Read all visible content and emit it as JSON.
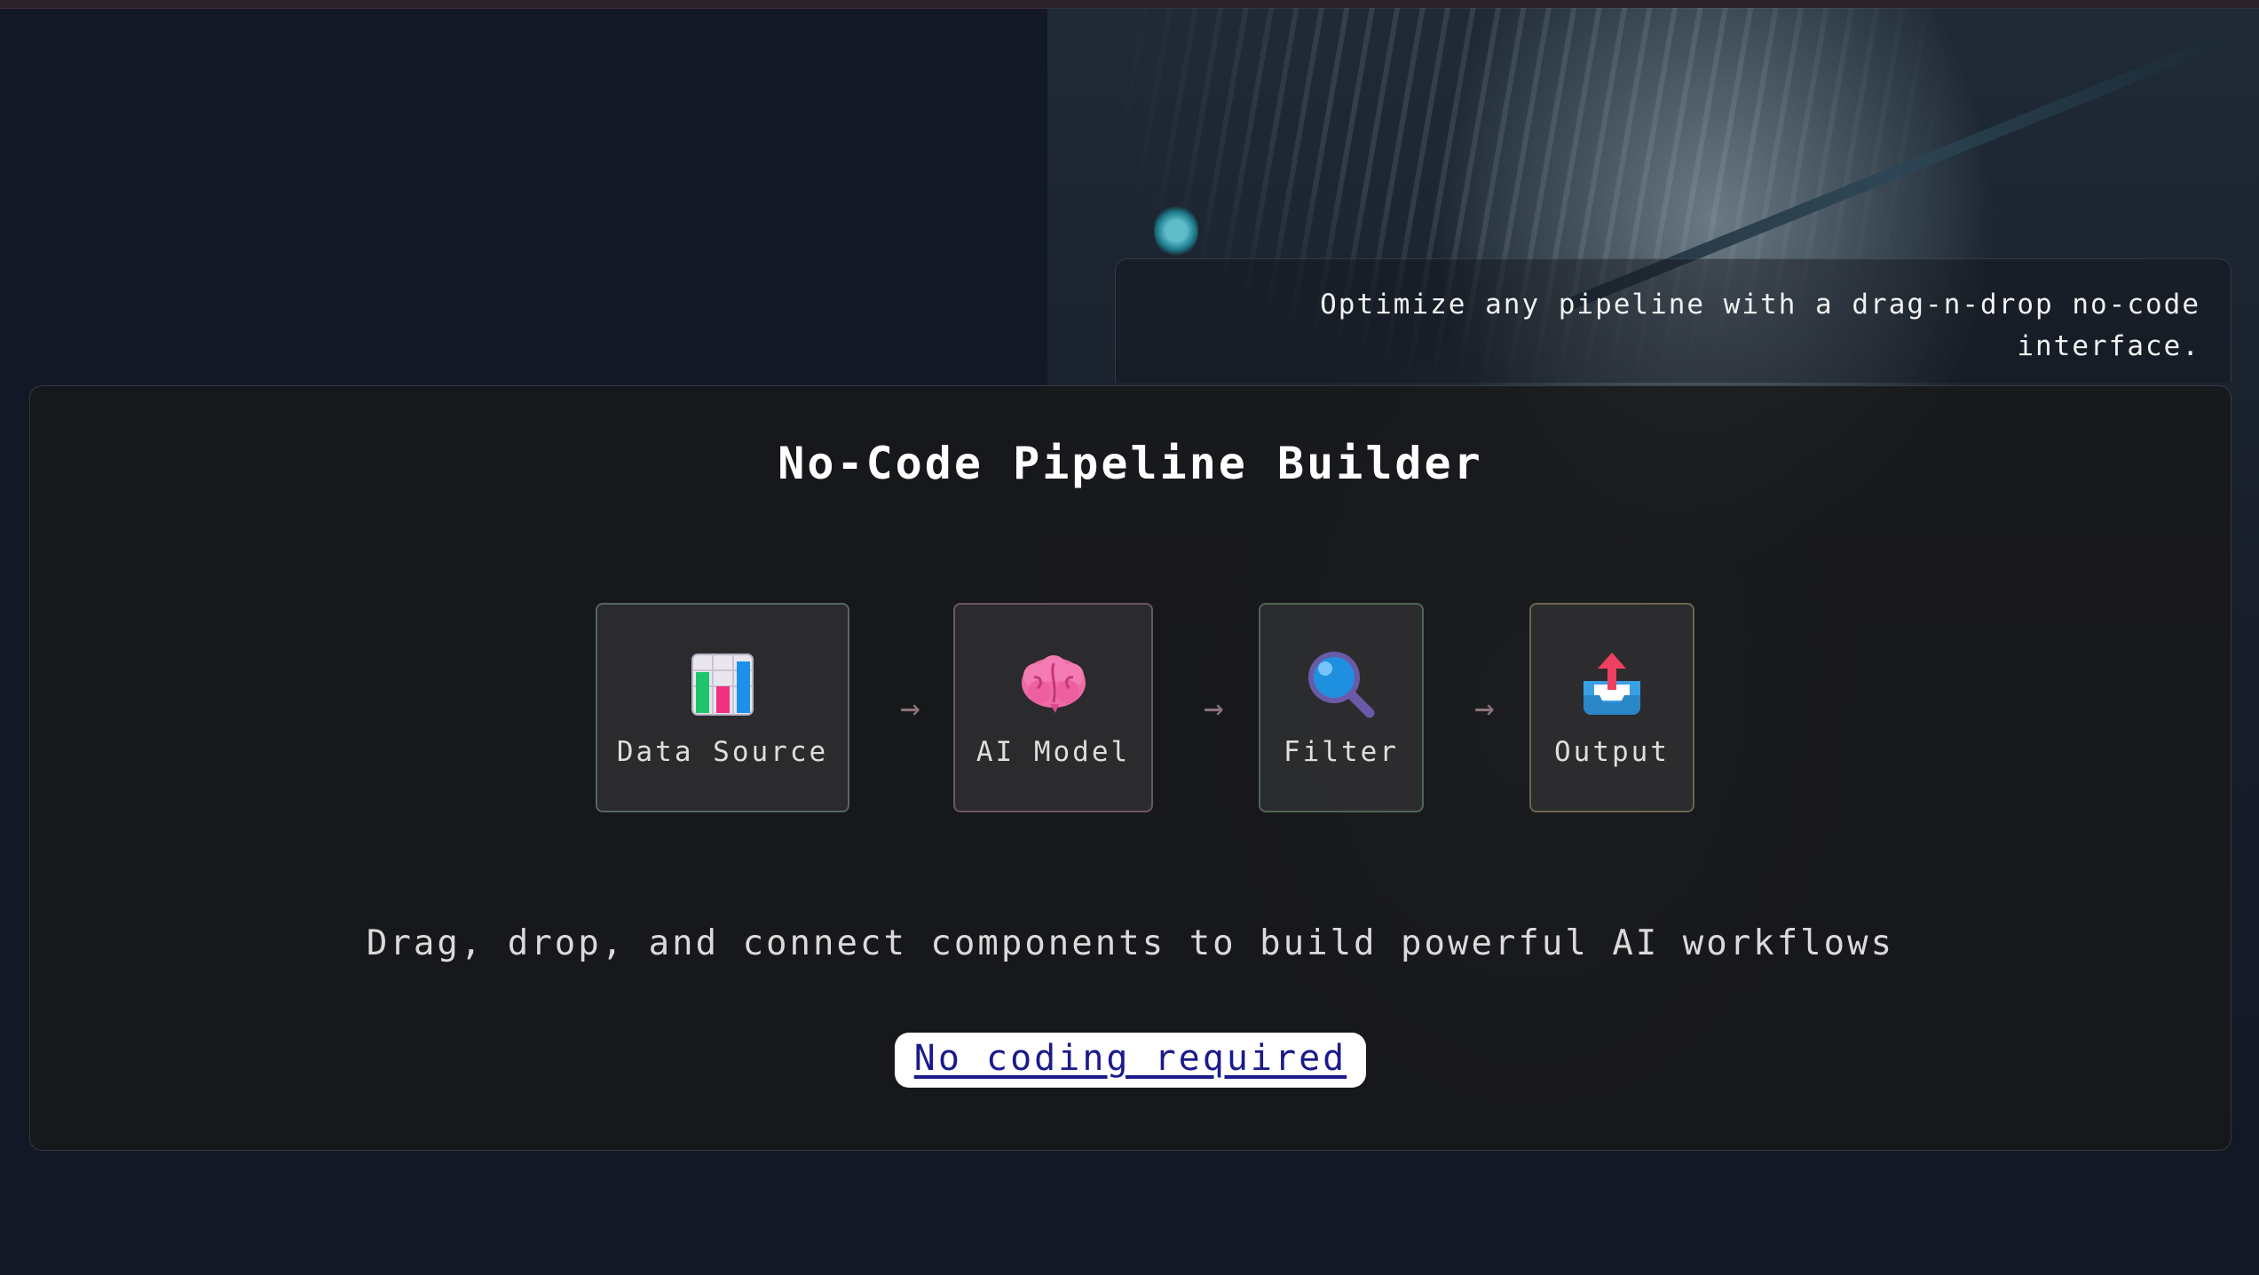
{
  "tagline": {
    "text": "Optimize any pipeline with a drag-n-drop no-code interface."
  },
  "card": {
    "title": "No-Code Pipeline Builder",
    "nodes": [
      {
        "label": "Data Source",
        "icon": "bar-chart-icon"
      },
      {
        "label": "AI Model",
        "icon": "brain-icon"
      },
      {
        "label": "Filter",
        "icon": "magnifier-icon"
      },
      {
        "label": "Output",
        "icon": "outbox-tray-icon"
      }
    ],
    "arrow": "→",
    "description": "Drag, drop, and connect components to build powerful AI workflows",
    "cta_label": "No coding required"
  },
  "colors": {
    "page_background": "#131826",
    "card_background": "#18181a",
    "cta_background": "#ffffff",
    "cta_text": "#1a1a8c"
  }
}
